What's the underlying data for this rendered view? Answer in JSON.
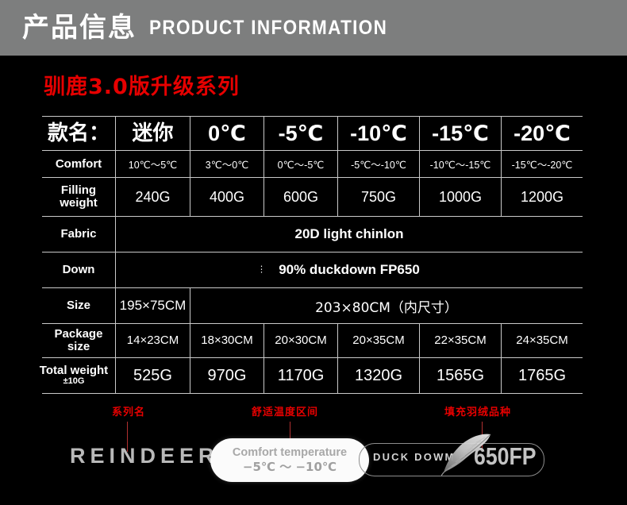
{
  "banner": {
    "title_cn": "产品信息",
    "title_en": "PRODUCT INFORMATION",
    "bg_color": "#7d7e7e"
  },
  "series_title": "驯鹿3.0版升级系列",
  "accent_color": "#e60000",
  "table": {
    "header": [
      "款名：",
      "迷你",
      "0℃",
      "-5℃",
      "-10℃",
      "-15℃",
      "-20℃"
    ],
    "rows": [
      {
        "label": "Comfort",
        "values": [
          "10℃～5℃",
          "3℃～0℃",
          "0℃～-5℃",
          "-5℃～-10℃",
          "-10℃～-15℃",
          "-15℃～-20℃"
        ]
      },
      {
        "label": "Filling weight",
        "label_line1": "Filling",
        "label_line2": "weight",
        "values": [
          "240G",
          "400G",
          "600G",
          "750G",
          "1000G",
          "1200G"
        ]
      },
      {
        "label": "Fabric",
        "span_value": "20D light chinlon"
      },
      {
        "label": "Down",
        "span_value": "90% duckdown FP650",
        "marker": "⋮"
      },
      {
        "label": "Size",
        "first_value": "195×75CM",
        "span_value": "203×80CM（内尺寸）"
      },
      {
        "label": "Package size",
        "label_line1": "Package",
        "label_line2": "size",
        "values": [
          "14×23CM",
          "18×30CM",
          "20×30CM",
          "20×35CM",
          "22×35CM",
          "24×35CM"
        ]
      },
      {
        "label": "Total weight ±10G",
        "label_line1": "Total weight",
        "label_line2": "±10G",
        "values": [
          "525G",
          "970G",
          "1170G",
          "1320G",
          "1565G",
          "1765G"
        ]
      }
    ]
  },
  "annotations": [
    {
      "text": "系列名"
    },
    {
      "text": "舒适温度区间"
    },
    {
      "text": "填充羽绒品种"
    }
  ],
  "brand_strip": {
    "brand": "REINDEER",
    "comfort_pill": {
      "line1": "Comfort temperature",
      "line2": "−5℃ ～ −10℃"
    },
    "duck_label": "DUCK DOWM",
    "fp_label": "650FP"
  }
}
